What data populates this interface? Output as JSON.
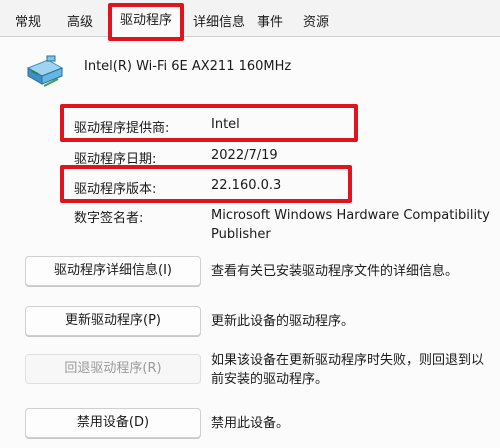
{
  "tabs": [
    "常规",
    "高级",
    "驱动程序",
    "详细信息",
    "事件",
    "资源"
  ],
  "device": {
    "name": "Intel(R) Wi-Fi 6E AX211 160MHz",
    "icon": "network-adapter-icon"
  },
  "properties": {
    "provider_label": "驱动程序提供商:",
    "provider_value": "Intel",
    "date_label": "驱动程序日期:",
    "date_value": "2022/7/19",
    "version_label": "驱动程序版本:",
    "version_value": "22.160.0.3",
    "signer_label": "数字签名者:",
    "signer_value": "Microsoft Windows Hardware Compatibility Publisher"
  },
  "actions": [
    {
      "label": "驱动程序详细信息(I)",
      "desc": "查看有关已安装驱动程序文件的详细信息。",
      "enabled": true
    },
    {
      "label": "更新驱动程序(P)",
      "desc": "更新此设备的驱动程序。",
      "enabled": true
    },
    {
      "label": "回退驱动程序(R)",
      "desc": "如果该设备在更新驱动程序时失败，则回退到以前安装的驱动程序。",
      "enabled": false
    },
    {
      "label": "禁用设备(D)",
      "desc": "禁用此设备。",
      "enabled": true
    }
  ],
  "colors": {
    "highlight": "#e0141e",
    "background": "#f3f3f3",
    "panel": "#fbfbfb"
  }
}
